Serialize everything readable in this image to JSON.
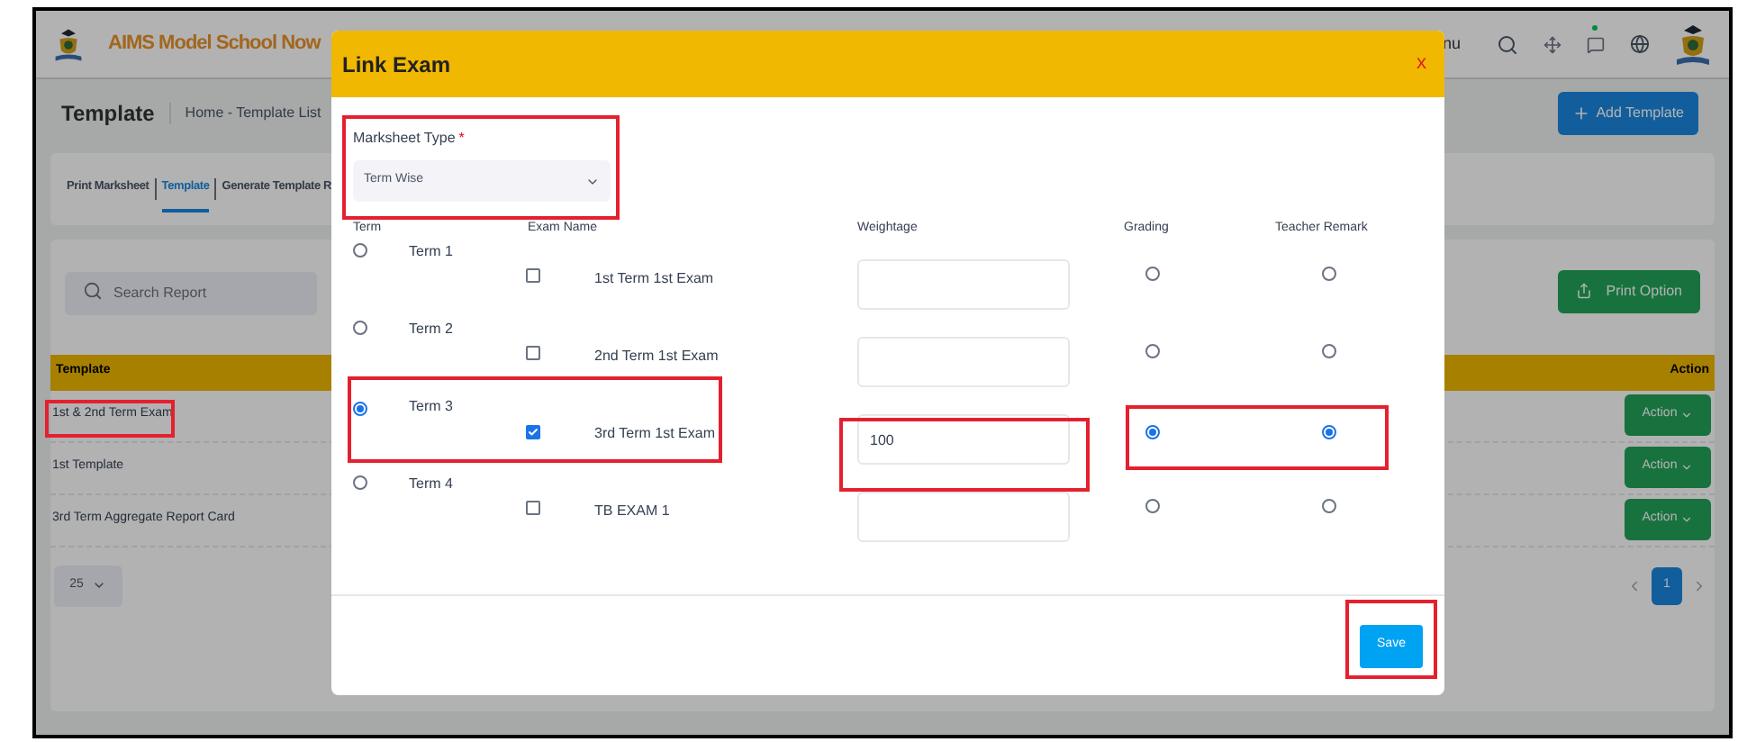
{
  "header": {
    "school_name": "AIMS Model School Now",
    "menu_text": "nu"
  },
  "page": {
    "title": "Template",
    "breadcrumb": [
      "Home",
      "-",
      "Template List"
    ],
    "add_button": "Add Template"
  },
  "tabs": [
    {
      "label": "Print Marksheet",
      "selected": false
    },
    {
      "label": "Template",
      "selected": true
    },
    {
      "label": "Generate Template R",
      "selected": false
    }
  ],
  "search": {
    "placeholder": "Search Report"
  },
  "print_button": "Print Option",
  "table": {
    "columns": [
      "Template",
      "Action"
    ],
    "rows": [
      {
        "template": "1st & 2nd Term Exam",
        "action": "Action"
      },
      {
        "template": "1st Template",
        "action": "Action"
      },
      {
        "template": "3rd Term Aggregate Report Card",
        "action": "Action"
      }
    ]
  },
  "pagination": {
    "page_size": "25",
    "pages": [
      {
        "label": "1",
        "selected": true
      }
    ]
  },
  "modal": {
    "title": "Link Exam",
    "close": "x",
    "field_label": "Marksheet Type",
    "required_mark": "*",
    "select_value": "Term Wise",
    "columns": [
      "Term",
      "Exam Name",
      "Weightage",
      "Grading",
      "Teacher Remark"
    ],
    "rows": [
      {
        "term": "Term 1",
        "selected": false,
        "exam": "1st Term 1st Exam",
        "checked": false,
        "weightage": "",
        "grading_selected": false,
        "remark_selected": false
      },
      {
        "term": "Term 2",
        "selected": false,
        "exam": "2nd Term 1st Exam",
        "checked": false,
        "weightage": "",
        "grading_selected": false,
        "remark_selected": false
      },
      {
        "term": "Term 3",
        "selected": true,
        "exam": "3rd Term 1st Exam",
        "checked": true,
        "weightage": "100",
        "grading_selected": true,
        "remark_selected": true
      },
      {
        "term": "Term 4",
        "selected": false,
        "exam": "TB EXAM 1",
        "checked": false,
        "weightage": "",
        "grading_selected": false,
        "remark_selected": false
      }
    ],
    "save_button": "Save"
  }
}
